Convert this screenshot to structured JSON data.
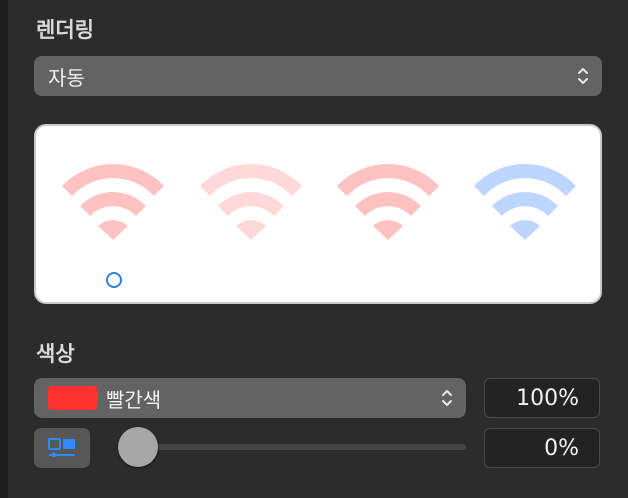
{
  "rendering": {
    "label": "렌더링",
    "popup_value": "자동"
  },
  "preview": {
    "symbols": [
      {
        "name": "wifi-red-symbol",
        "color": "#ffc2c2",
        "opacity": 1.0
      },
      {
        "name": "wifi-light-red-symbol",
        "color": "#ffd6d6",
        "opacity": 1.0
      },
      {
        "name": "wifi-red-symbol-2",
        "color": "#ffc2c2",
        "opacity": 1.0
      },
      {
        "name": "wifi-blue-symbol",
        "color": "#bcd6ff",
        "opacity": 1.0
      }
    ],
    "selected_index": 0,
    "selection_color": "#2f7fe0"
  },
  "color": {
    "label": "색상",
    "swatch_color": "#ff3030",
    "popup_value": "빨간색",
    "opacity_value": "100%",
    "offset_value": "0%",
    "slider_fraction": 0.0
  },
  "icons": {
    "render_chevron": "up-down-chevron-icon",
    "color_chevron": "up-down-chevron-icon",
    "mode_button": "palette-mode-icon"
  }
}
